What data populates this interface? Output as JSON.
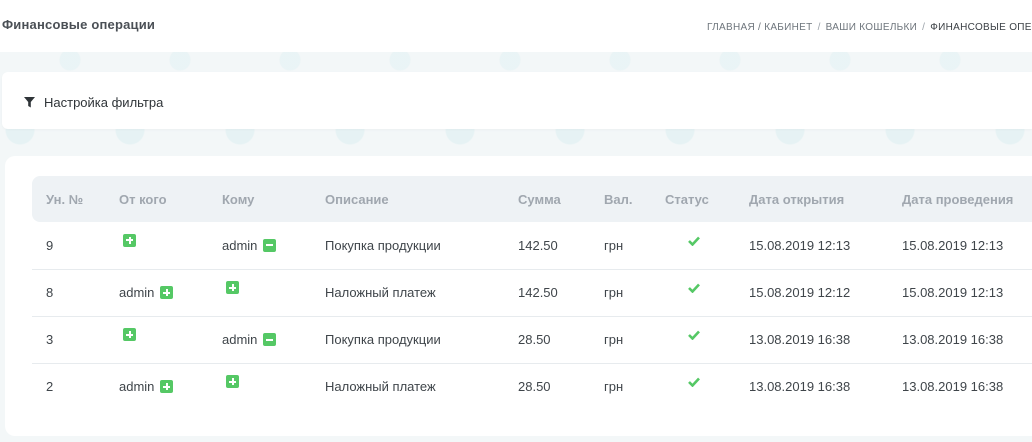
{
  "page": {
    "title": "Финансовые операции"
  },
  "breadcrumb": {
    "items": [
      "ГЛАВНАЯ / КАБИНЕТ",
      "ВАШИ КОШЕЛЬКИ",
      "ФИНАНСОВЫЕ ОПЕРАЦИИ"
    ],
    "separator": "/"
  },
  "filter": {
    "label": "Настройка фильтра",
    "icon": "filter-icon"
  },
  "table": {
    "headers": [
      "Ун. №",
      "От кого",
      "Кому",
      "Описание",
      "Сумма",
      "Вал.",
      "Статус",
      "Дата открытия",
      "Дата проведения"
    ],
    "rows": [
      {
        "id": "9",
        "from": "",
        "from_icon": "plus-square-icon",
        "to": "admin",
        "to_icon": "minus-square-icon",
        "description": "Покупка продукции",
        "amount": "142.50",
        "currency": "грн",
        "status_icon": "check-icon",
        "opened": "15.08.2019 12:13",
        "completed": "15.08.2019 12:13"
      },
      {
        "id": "8",
        "from": "admin",
        "from_icon": "plus-square-icon",
        "to": "",
        "to_icon": "plus-square-icon",
        "description": "Наложный платеж",
        "amount": "142.50",
        "currency": "грн",
        "status_icon": "check-icon",
        "opened": "15.08.2019 12:12",
        "completed": "15.08.2019 12:13"
      },
      {
        "id": "3",
        "from": "",
        "from_icon": "plus-square-icon",
        "to": "admin",
        "to_icon": "minus-square-icon",
        "description": "Покупка продукции",
        "amount": "28.50",
        "currency": "грн",
        "status_icon": "check-icon",
        "opened": "13.08.2019 16:38",
        "completed": "13.08.2019 16:38"
      },
      {
        "id": "2",
        "from": "admin",
        "from_icon": "plus-square-icon",
        "to": "",
        "to_icon": "plus-square-icon",
        "description": "Наложный платеж",
        "amount": "28.50",
        "currency": "грн",
        "status_icon": "check-icon",
        "opened": "13.08.2019 16:38",
        "completed": "13.08.2019 16:38"
      }
    ]
  },
  "colors": {
    "accent_green": "#55c865",
    "header_bg": "#eef2f5",
    "background": "#f3f7f8"
  }
}
